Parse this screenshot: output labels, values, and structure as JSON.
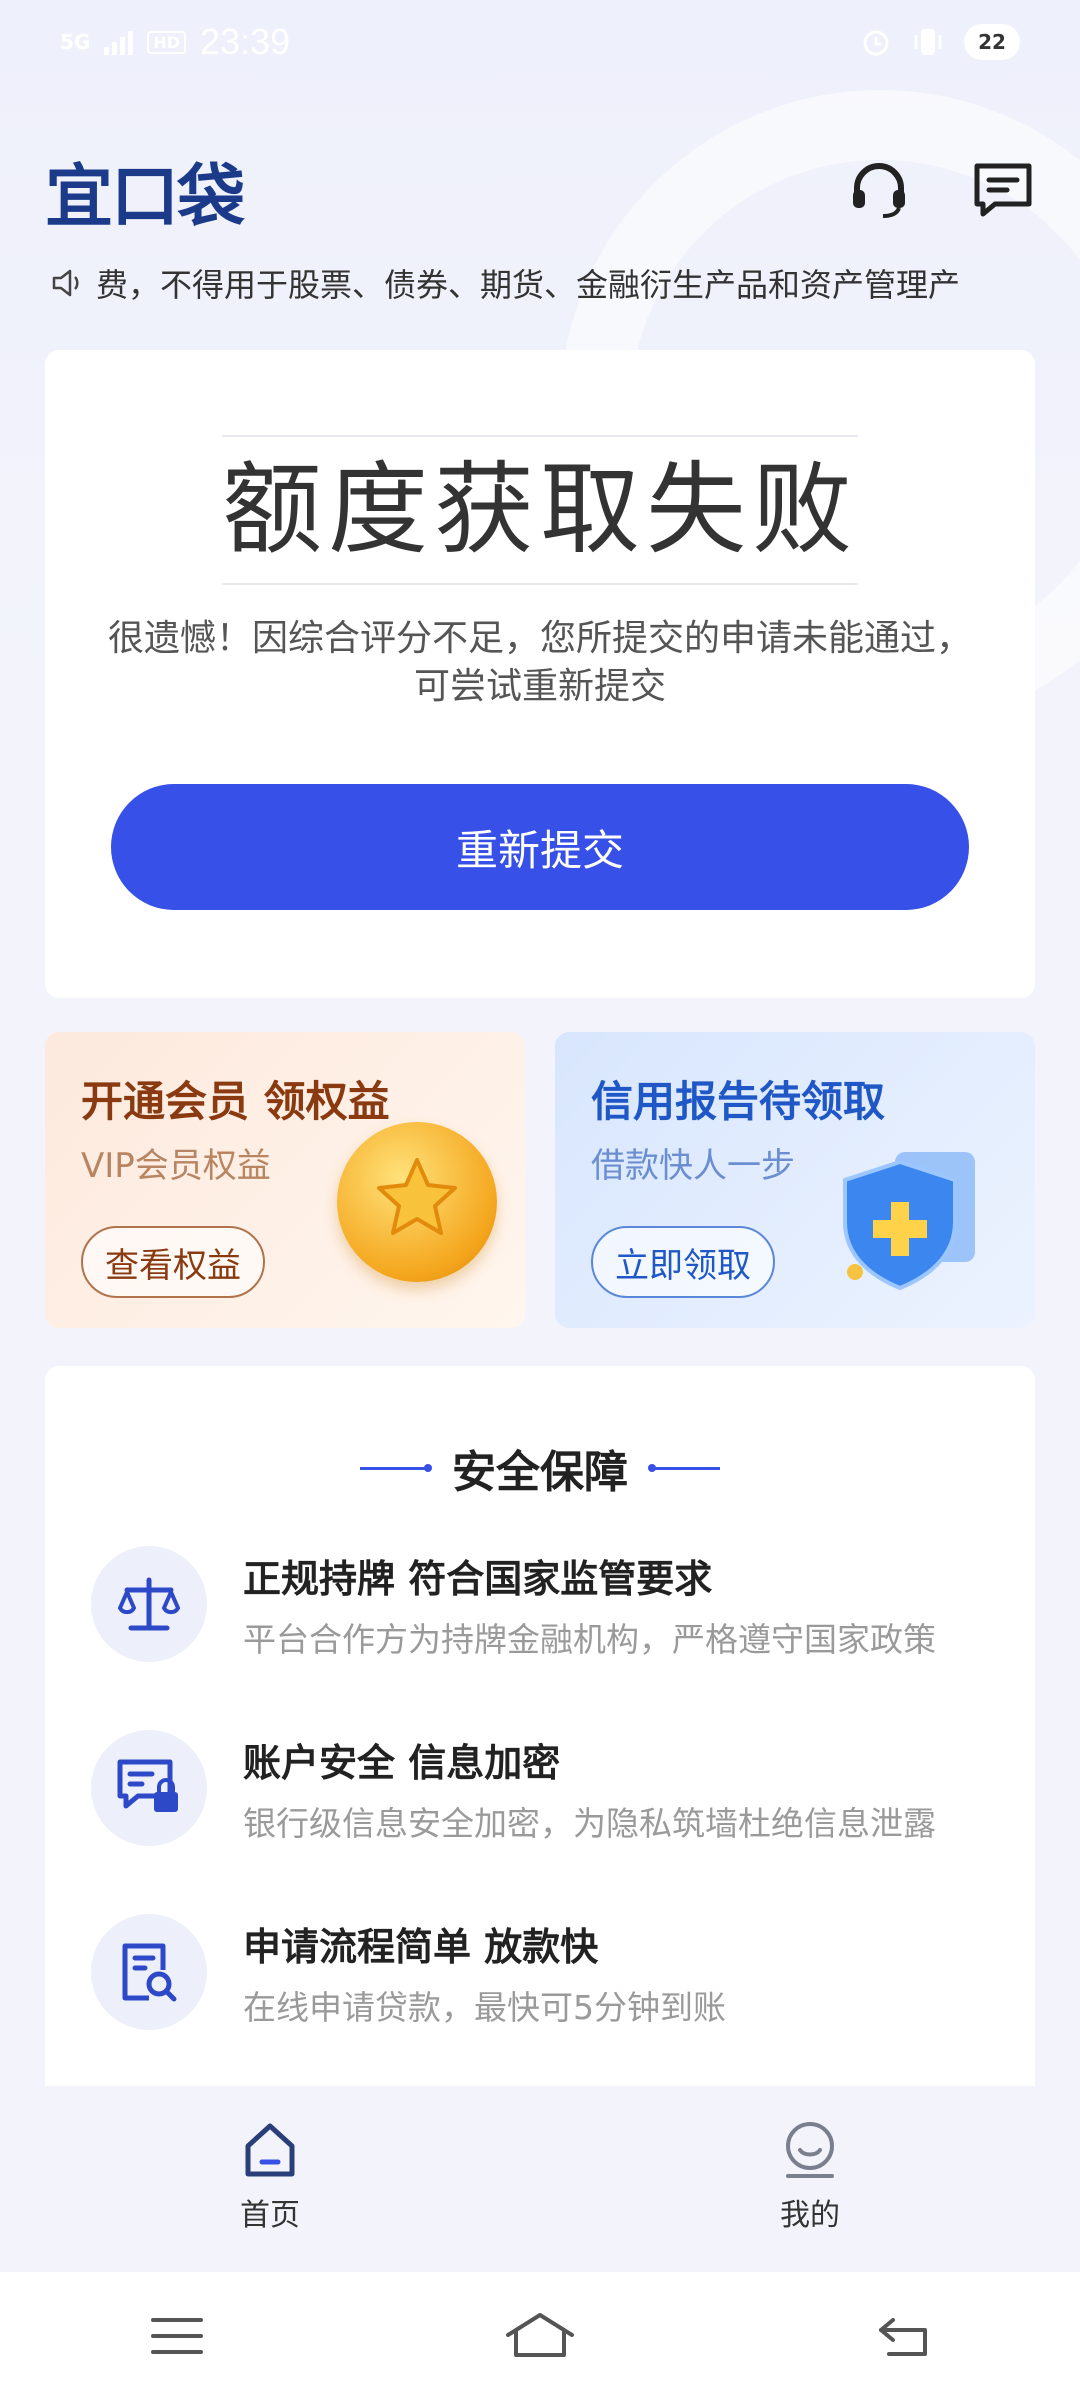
{
  "status_bar": {
    "network": "5G",
    "hd": "HD",
    "time": "23:39",
    "battery": "22"
  },
  "header": {
    "logo": "宜口袋",
    "support_icon": "headset-icon",
    "message_icon": "message-icon"
  },
  "notice": {
    "icon": "speaker-icon",
    "text": "费，不得用于股票、债券、期货、金融衍生产品和资产管理产"
  },
  "result_card": {
    "title": "额度获取失败",
    "description": "很遗憾！因综合评分不足，您所提交的申请未能通过，可尝试重新提交",
    "button": "重新提交",
    "accent_color": "#3650e8"
  },
  "promos": [
    {
      "title": "开通会员 领权益",
      "subtitle": "VIP会员权益",
      "button": "查看权益",
      "icon": "gold-coin-icon"
    },
    {
      "title": "信用报告待领取",
      "subtitle": "借款快人一步",
      "button": "立即领取",
      "icon": "shield-icon"
    }
  ],
  "safety": {
    "heading": "安全保障",
    "items": [
      {
        "title": "正规持牌 符合国家监管要求",
        "subtitle": "平台合作方为持牌金融机构，严格遵守国家政策",
        "icon": "scale-icon"
      },
      {
        "title": "账户安全 信息加密",
        "subtitle": "银行级信息安全加密，为隐私筑墙杜绝信息泄露",
        "icon": "secure-card-icon"
      },
      {
        "title": "申请流程简单 放款快",
        "subtitle": "在线申请贷款，最快可5分钟到账",
        "icon": "document-search-icon"
      }
    ]
  },
  "tabs": [
    {
      "label": "首页",
      "icon": "home-icon",
      "active": true
    },
    {
      "label": "我的",
      "icon": "profile-icon",
      "active": false
    }
  ],
  "system_nav": [
    "menu-icon",
    "home-nav-icon",
    "back-icon"
  ]
}
